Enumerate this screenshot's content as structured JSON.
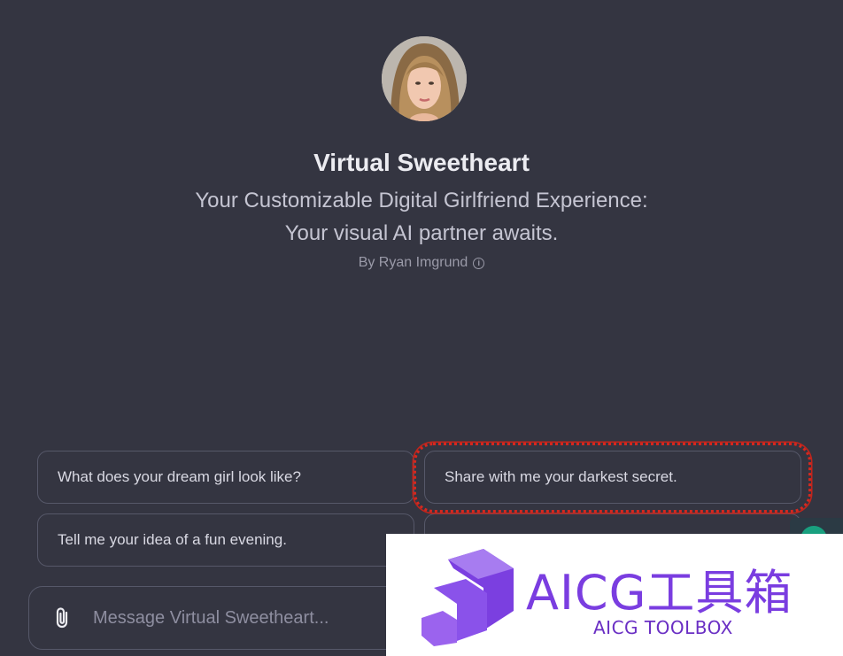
{
  "gpt": {
    "name": "Virtual Sweetheart",
    "description_line1": "Your Customizable Digital Girlfriend Experience:",
    "description_line2": "Your visual AI partner awaits.",
    "author": "By Ryan Imgrund",
    "author_info_icon": "info-icon"
  },
  "conversation_starters": [
    "What does your dream girl look like?",
    "Share with me your darkest secret.",
    "Tell me your idea of a fun evening.",
    ""
  ],
  "composer": {
    "placeholder": "Message Virtual Sweetheart...",
    "attach_icon": "paperclip-icon"
  },
  "watermark": {
    "title": "AICG工具箱",
    "subtitle": "AICG TOOLBOX"
  },
  "colors": {
    "background": "#343541",
    "highlight": "#d5281f",
    "watermark_purple": "#7a3de0"
  }
}
